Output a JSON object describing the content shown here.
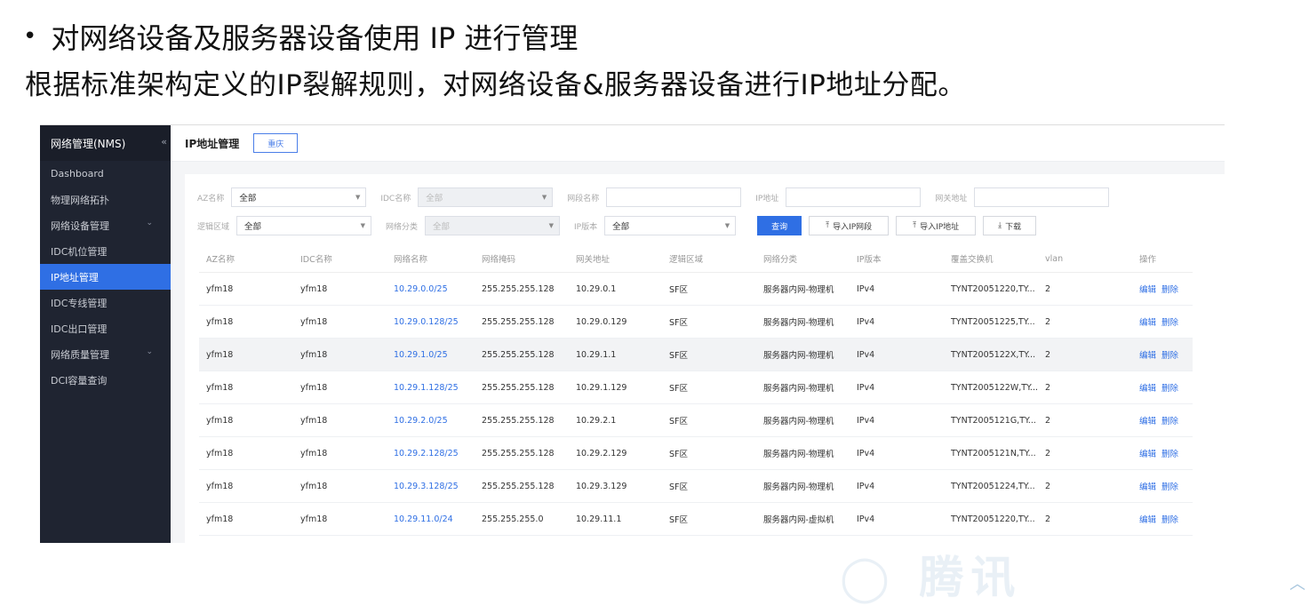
{
  "slide": {
    "bullet_text": "对网络设备及服务器设备使用 IP 进行管理",
    "subtitle": "根据标准架构定义的IP裂解规则，对网络设备&服务器设备进行IP地址分配。"
  },
  "sidebar": {
    "brand": "网络管理(NMS)",
    "collapse_icon": "«",
    "items": [
      {
        "label": "Dashboard"
      },
      {
        "label": "物理网络拓扑"
      },
      {
        "label": "网络设备管理"
      },
      {
        "label": "IDC机位管理"
      },
      {
        "label": "IP地址管理"
      },
      {
        "label": "IDC专线管理"
      },
      {
        "label": "IDC出口管理"
      },
      {
        "label": "网络质量管理"
      },
      {
        "label": "DCI容量查询"
      }
    ]
  },
  "header": {
    "title": "IP地址管理",
    "city_button": "重庆"
  },
  "filters": {
    "az_label": "AZ名称",
    "az_value": "全部",
    "idc_label": "IDC名称",
    "idc_value": "全部",
    "segment_label": "网段名称",
    "ip_label": "IP地址",
    "gateway_label": "网关地址",
    "zone_label": "逻辑区域",
    "zone_value": "全部",
    "netclass_label": "网络分类",
    "netclass_value": "全部",
    "ipver_label": "IP版本",
    "ipver_value": "全部"
  },
  "actions": {
    "query": "查询",
    "import_segment": "导入IP网段",
    "import_ip": "导入IP地址",
    "download": "下载"
  },
  "table": {
    "headers": [
      "AZ名称",
      "IDC名称",
      "网络名称",
      "网络掩码",
      "网关地址",
      "逻辑区域",
      "网络分类",
      "IP版本",
      "覆盖交换机",
      "vlan",
      "操作"
    ],
    "edit_label": "编辑",
    "delete_label": "删除",
    "rows": [
      [
        "yfm18",
        "yfm18",
        "10.29.0.0/25",
        "255.255.255.128",
        "10.29.0.1",
        "SF区",
        "服务器内网-物理机",
        "IPv4",
        "TYNT20051220,TY...",
        "2"
      ],
      [
        "yfm18",
        "yfm18",
        "10.29.0.128/25",
        "255.255.255.128",
        "10.29.0.129",
        "SF区",
        "服务器内网-物理机",
        "IPv4",
        "TYNT20051225,TY...",
        "2"
      ],
      [
        "yfm18",
        "yfm18",
        "10.29.1.0/25",
        "255.255.255.128",
        "10.29.1.1",
        "SF区",
        "服务器内网-物理机",
        "IPv4",
        "TYNT2005122X,TY...",
        "2"
      ],
      [
        "yfm18",
        "yfm18",
        "10.29.1.128/25",
        "255.255.255.128",
        "10.29.1.129",
        "SF区",
        "服务器内网-物理机",
        "IPv4",
        "TYNT2005122W,TY...",
        "2"
      ],
      [
        "yfm18",
        "yfm18",
        "10.29.2.0/25",
        "255.255.255.128",
        "10.29.2.1",
        "SF区",
        "服务器内网-物理机",
        "IPv4",
        "TYNT2005121G,TY...",
        "2"
      ],
      [
        "yfm18",
        "yfm18",
        "10.29.2.128/25",
        "255.255.255.128",
        "10.29.2.129",
        "SF区",
        "服务器内网-物理机",
        "IPv4",
        "TYNT2005121N,TY...",
        "2"
      ],
      [
        "yfm18",
        "yfm18",
        "10.29.3.128/25",
        "255.255.255.128",
        "10.29.3.129",
        "SF区",
        "服务器内网-物理机",
        "IPv4",
        "TYNT20051224,TY...",
        "2"
      ],
      [
        "yfm18",
        "yfm18",
        "10.29.11.0/24",
        "255.255.255.0",
        "10.29.11.1",
        "SF区",
        "服务器内网-虚拟机",
        "IPv4",
        "TYNT20051220,TY...",
        "2"
      ]
    ]
  },
  "colors": {
    "accent": "#2f6fe4",
    "sidebar_bg": "#1f2431"
  }
}
